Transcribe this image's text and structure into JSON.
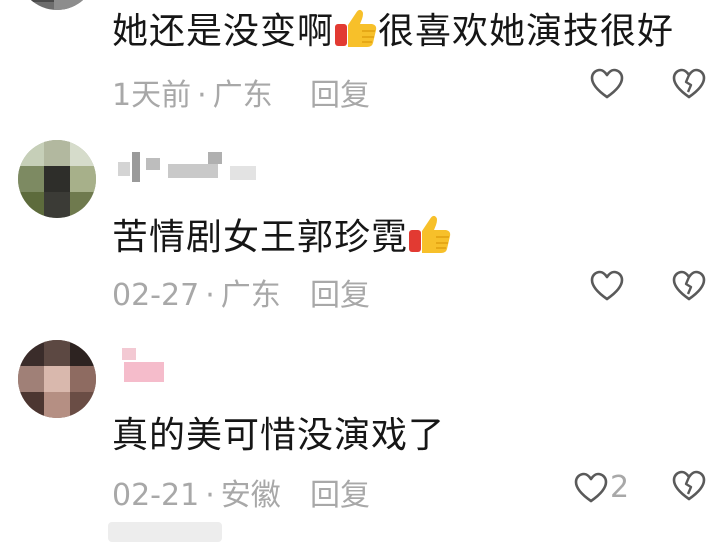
{
  "comments": [
    {
      "text": "她还是没变啊",
      "text_after_emoji": "很喜欢她演技很好",
      "date": "1天前",
      "location": "广东",
      "reply_label": "回复",
      "like_count": ""
    },
    {
      "text": "苦情剧女王郭珍霓",
      "text_after_emoji": "",
      "date": "02-27",
      "location": "广东",
      "reply_label": "回复",
      "like_count": ""
    },
    {
      "text": "真的美可惜没演戏了",
      "text_after_emoji": "",
      "date": "02-21",
      "location": "安徽",
      "reply_label": "回复",
      "like_count": "2"
    }
  ],
  "meta_separator": "·",
  "icons": {
    "emoji": "thumbs-up-icon",
    "like": "heart-outline-icon",
    "dislike": "broken-heart-icon"
  },
  "colors": {
    "text": "#161616",
    "meta": "#a8a8a8",
    "icon": "#5a5a5a",
    "thumb_yellow": "#f7c02a",
    "thumb_red": "#e23a32"
  }
}
